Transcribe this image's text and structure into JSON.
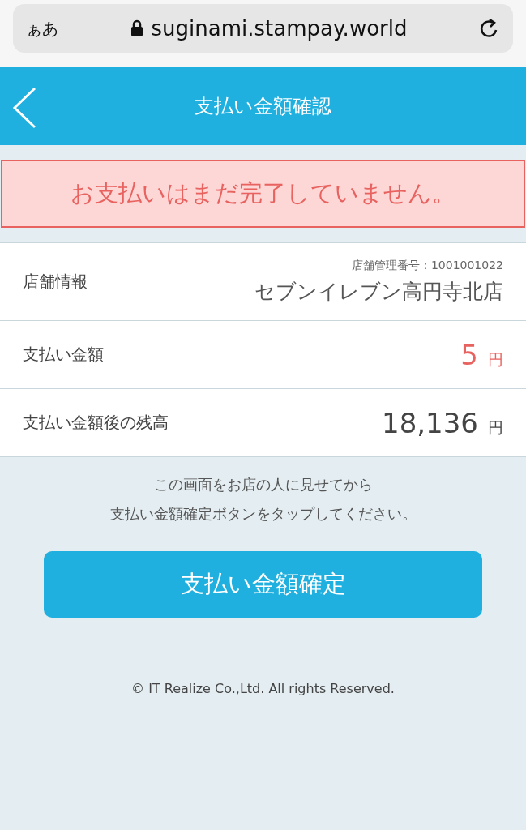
{
  "browser": {
    "text_size": "ぁあ",
    "url": "suginami.stampay.world"
  },
  "header": {
    "title": "支払い金額確認"
  },
  "alert": {
    "message": "お支払いはまだ完了していません。"
  },
  "rows": [
    {
      "kind": "store",
      "label": "店舗情報",
      "sub": "店舗管理番号：1001001022",
      "value": "セブンイレブン高円寺北店"
    },
    {
      "kind": "amount",
      "label": "支払い金額",
      "value": "5",
      "unit": "円",
      "highlight": true
    },
    {
      "kind": "amount",
      "label": "支払い金額後の残高",
      "value": "18,136",
      "unit": "円",
      "highlight": false
    }
  ],
  "instructions": [
    "この画面をお店の人に見せてから",
    "支払い金額確定ボタンをタップしてください。"
  ],
  "confirm_button": "支払い金額確定",
  "footer": "© IT Realize Co.,Ltd. All rights Reserved."
}
